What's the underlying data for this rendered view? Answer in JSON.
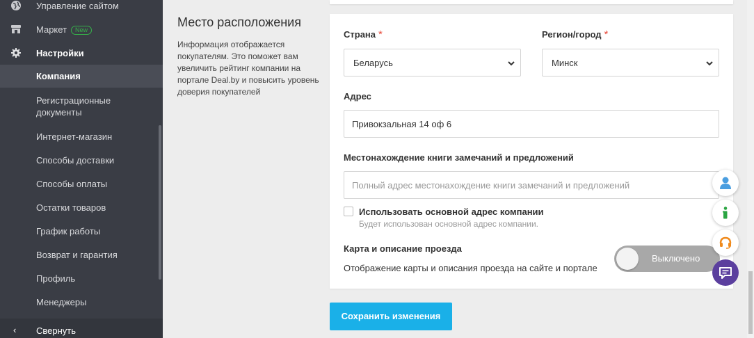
{
  "sidebar": {
    "items": [
      {
        "label": "Управление сайтом",
        "icon": "globe-icon"
      },
      {
        "label": "Маркет",
        "icon": "store-icon",
        "badge": "New"
      },
      {
        "label": "Настройки",
        "icon": "gear-icon"
      },
      {
        "label": "Компания"
      },
      {
        "label": "Регистрационные\nдокументы"
      },
      {
        "label": "Интернет-магазин"
      },
      {
        "label": "Способы доставки"
      },
      {
        "label": "Способы оплаты"
      },
      {
        "label": "Остатки товаров"
      },
      {
        "label": "График работы"
      },
      {
        "label": "Возврат и гарантия"
      },
      {
        "label": "Профиль"
      },
      {
        "label": "Менеджеры"
      }
    ],
    "collapse_label": "Свернуть"
  },
  "section": {
    "title": "Место расположения",
    "description": "Информация отображается покупателям. Это поможет вам увеличить рейтинг компании на портале Deal.by и повысить уровень доверия покупателей"
  },
  "form": {
    "country_label": "Страна",
    "country_value": "Беларусь",
    "region_label": "Регион/город",
    "region_value": "Минск",
    "required_mark": "*",
    "address_label": "Адрес",
    "address_value": "Привокзальная 14 оф 6",
    "book_label": "Местонахождение книги замечаний и предложений",
    "book_placeholder": "Полный адрес местонахождение книги замечаний и предложений",
    "use_main_label": "Использовать основной адрес компании",
    "use_main_hint": "Будет использован основной адрес компании.",
    "map_title": "Карта и описание проезда",
    "map_desc": "Отображение карты и описания проезда на сайте и портале",
    "map_toggle_label": "Выключено",
    "map_toggle_on": false
  },
  "save_label": "Сохранить изменения",
  "colors": {
    "accent": "#1ab0e8",
    "sidebar": "#3a3d45",
    "chat": "#5b3f9e",
    "required": "#e84c3d",
    "badge": "#36b24a"
  }
}
